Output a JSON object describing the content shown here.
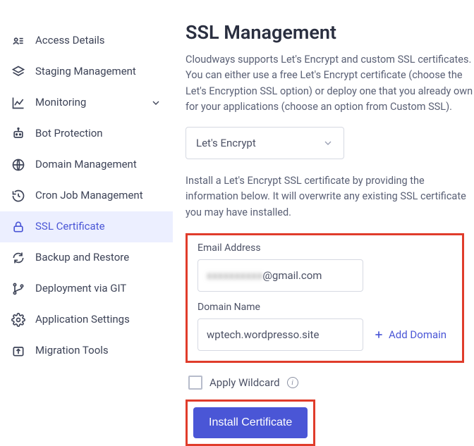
{
  "sidebar": {
    "items": [
      {
        "label": "Access Details"
      },
      {
        "label": "Staging Management"
      },
      {
        "label": "Monitoring"
      },
      {
        "label": "Bot Protection"
      },
      {
        "label": "Domain Management"
      },
      {
        "label": "Cron Job Management"
      },
      {
        "label": "SSL Certificate"
      },
      {
        "label": "Backup and Restore"
      },
      {
        "label": "Deployment via GIT"
      },
      {
        "label": "Application Settings"
      },
      {
        "label": "Migration Tools"
      }
    ]
  },
  "main": {
    "title": "SSL Management",
    "description": "Cloudways supports Let's Encrypt and custom SSL certificates. You can either use a free Let's Encrypt certificate (choose the Let's Encryption SSL option) or deploy one that you already own for your applications (choose an option from Custom SSL).",
    "ssl_select": "Let's Encrypt",
    "install_desc": "Install a Let's Encrypt SSL certificate by providing the information below. It will overwrite any existing SSL certificate you may have installed.",
    "email_label": "Email Address",
    "email_blurred": "xxxxxxxxxx",
    "email_suffix": "@gmail.com",
    "domain_label": "Domain Name",
    "domain_value": "wptech.wordpresso.site",
    "add_domain": "Add Domain",
    "wildcard_label": "Apply Wildcard",
    "install_btn": "Install Certificate"
  }
}
